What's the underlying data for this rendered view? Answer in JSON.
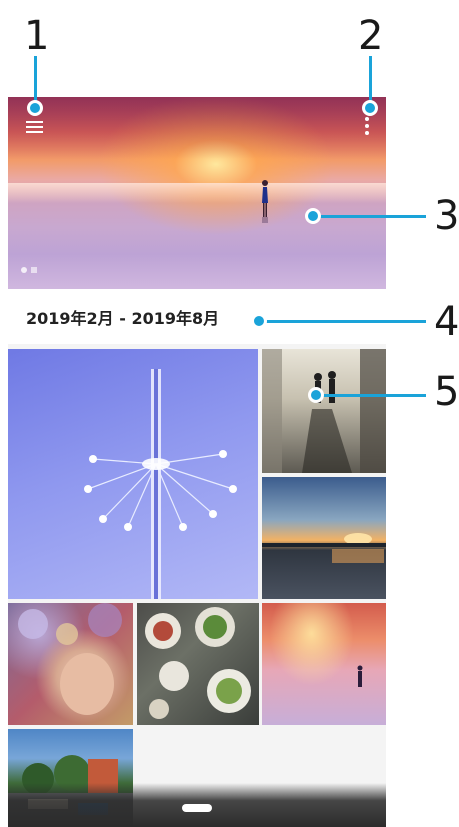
{
  "callouts": [
    "1",
    "2",
    "3",
    "4",
    "5"
  ],
  "date_range": "2019年2月 - 2019年8月",
  "icons": {
    "menu": "hamburger-menu-icon",
    "more": "more-vertical-icon",
    "home": "home-pill-icon"
  },
  "colors": {
    "callout_accent": "#1aa3d9"
  }
}
